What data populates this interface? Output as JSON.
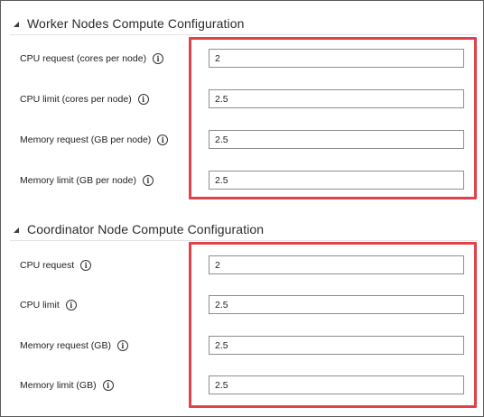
{
  "worker": {
    "title": "Worker Nodes Compute Configuration",
    "fields": [
      {
        "label": "CPU request (cores per node)",
        "value": "2"
      },
      {
        "label": "CPU limit (cores per node)",
        "value": "2.5"
      },
      {
        "label": "Memory request (GB per node)",
        "value": "2.5"
      },
      {
        "label": "Memory limit (GB per node)",
        "value": "2.5"
      }
    ]
  },
  "coordinator": {
    "title": "Coordinator Node Compute Configuration",
    "fields": [
      {
        "label": "CPU request",
        "value": "2"
      },
      {
        "label": "CPU limit",
        "value": "2.5"
      },
      {
        "label": "Memory request (GB)",
        "value": "2.5"
      },
      {
        "label": "Memory limit (GB)",
        "value": "2.5"
      }
    ]
  },
  "info_glyph": "i",
  "highlight_color": "#e0414b"
}
